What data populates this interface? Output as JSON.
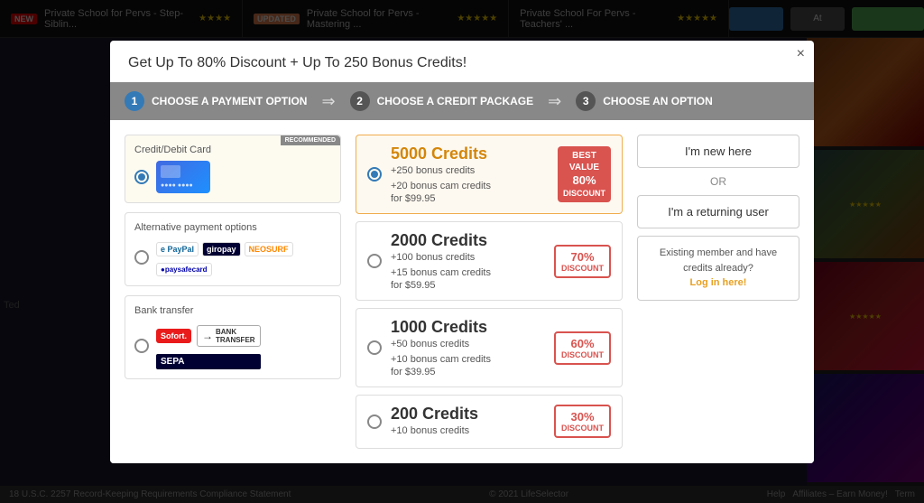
{
  "modal": {
    "title": "Get Up To 80% Discount + Up To 250 Bonus Credits!",
    "close_label": "×",
    "steps": [
      {
        "num": "1",
        "label": "CHOOSE A PAYMENT OPTION",
        "active": true
      },
      {
        "num": "2",
        "label": "CHOOSE A CREDIT PACKAGE",
        "active": false
      },
      {
        "num": "3",
        "label": "CHOOSE AN OPTION",
        "active": false
      }
    ],
    "payment_options": [
      {
        "id": "card",
        "label": "Credit/Debit Card",
        "selected": true,
        "recommended": "RECOMMENDED"
      },
      {
        "id": "alt",
        "label": "Alternative payment options",
        "selected": false
      },
      {
        "id": "bank",
        "label": "Bank transfer",
        "selected": false
      }
    ],
    "credit_packages": [
      {
        "id": "5000",
        "amount": "5000 Credits",
        "bonus1": "+250 bonus credits",
        "bonus2": "+20 bonus cam credits",
        "price": "for $99.95",
        "badge_type": "best_value",
        "badge_line1": "BEST",
        "badge_line2": "VALUE",
        "badge_line3": "80%",
        "badge_line4": "DISCOUNT",
        "selected": true
      },
      {
        "id": "2000",
        "amount": "2000 Credits",
        "bonus1": "+100 bonus credits",
        "bonus2": "+15 bonus cam credits",
        "price": "for $59.95",
        "badge_type": "discount",
        "badge_text": "70%\nDISCOUNT",
        "selected": false
      },
      {
        "id": "1000",
        "amount": "1000 Credits",
        "bonus1": "+50 bonus credits",
        "bonus2": "+10 bonus cam credits",
        "price": "for $39.95",
        "badge_type": "discount",
        "badge_text": "60%\nDISCOUNT",
        "selected": false
      },
      {
        "id": "200",
        "amount": "200 Credits",
        "bonus1": "+10 bonus credits",
        "bonus2": "",
        "price": "",
        "badge_type": "discount",
        "badge_text": "30%\nDISCOUNT",
        "selected": false
      }
    ],
    "user_options": {
      "new_label": "I'm new here",
      "or": "OR",
      "returning_label": "I'm a returning user",
      "existing_text": "Existing member and have credits already?",
      "login_label": "Log in here!"
    }
  },
  "background": {
    "movies": [
      {
        "title": "Private School for Pervs - Step-Siblin...",
        "badge": "NEW",
        "stars": "★★★★"
      },
      {
        "title": "Private School for Pervs - Mastering ...",
        "badge": "UPDATED",
        "stars": "★★★★★"
      },
      {
        "title": "Private School For Pervs - Teachers' ...",
        "badge": "",
        "stars": "★★★★★"
      }
    ]
  },
  "bottom_bar": {
    "legal": "18 U.S.C. 2257 Record-Keeping Requirements Compliance Statement",
    "copyright": "© 2021 LifeSelector",
    "links": [
      "Help",
      "Affiliates – Earn Money!",
      "Term"
    ]
  },
  "help_btn": "HELP"
}
